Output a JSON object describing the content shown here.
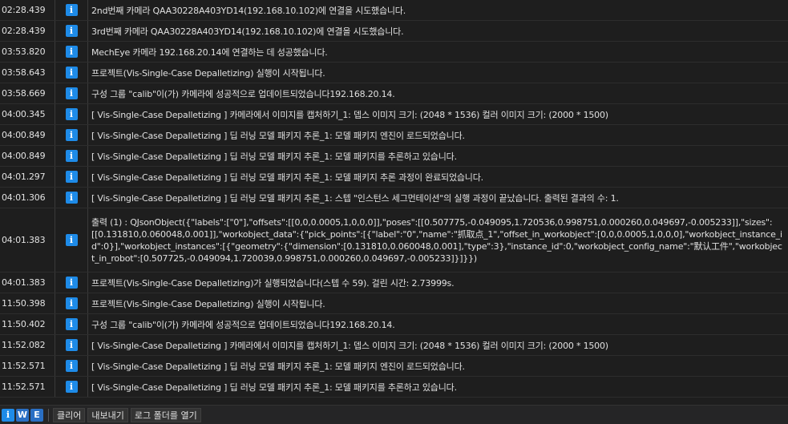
{
  "log_rows": [
    {
      "time": "02:28.439",
      "level": "i",
      "message": "2nd번째 카메라 QAA30228A403YD14(192.168.10.102)에 연결을 시도했습니다."
    },
    {
      "time": "02:28.439",
      "level": "i",
      "message": "3rd번째 카메라 QAA30228A403YD14(192.168.10.102)에 연결을 시도했습니다."
    },
    {
      "time": "03:53.820",
      "level": "i",
      "message": "MechEye 카메라 192.168.20.14에 연결하는 데 성공했습니다."
    },
    {
      "time": "03:58.643",
      "level": "i",
      "message": "프로젝트(Vis-Single-Case Depalletizing) 실행이 시작됩니다."
    },
    {
      "time": "03:58.669",
      "level": "i",
      "message": "구성 그룹 \"calib\"이(가) 카메라에 성공적으로 업데이트되었습니다192.168.20.14."
    },
    {
      "time": "04:00.345",
      "level": "i",
      "message": "[ Vis-Single-Case Depalletizing ] 카메라에서 이미지를 캡처하기_1: 뎁스 이미지 크기: (2048 * 1536)  컬러 이미지 크기: (2000 * 1500)"
    },
    {
      "time": "04:00.849",
      "level": "i",
      "message": "[ Vis-Single-Case Depalletizing ] 딥 러닝 모델 패키지 추론_1: 모델 패키지 엔진이 로드되었습니다."
    },
    {
      "time": "04:00.849",
      "level": "i",
      "message": "[ Vis-Single-Case Depalletizing ] 딥 러닝 모델 패키지 추론_1: 모델 패키지를 추론하고 있습니다."
    },
    {
      "time": "04:01.297",
      "level": "i",
      "message": "[ Vis-Single-Case Depalletizing ] 딥 러닝 모델 패키지 추론_1: 모델 패키지 추론 과정이 완료되었습니다."
    },
    {
      "time": "04:01.306",
      "level": "i",
      "message": "[ Vis-Single-Case Depalletizing ] 딥 러닝 모델 패키지 추론_1: 스텝 \"인스턴스 세그먼테이션\"의 실행 과정이 끝났습니다. 출력된 결과의 수: 1."
    },
    {
      "time": "04:01.383",
      "level": "i",
      "tall": true,
      "message": "출력 (1) : QJsonObject({\"labels\":[\"0\"],\"offsets\":[[0,0,0.0005,1,0,0,0]],\"poses\":[[0.507775,-0.049095,1.720536,0.998751,0.000260,0.049697,-0.005233]],\"sizes\":[[0.131810,0.060048,0.001]],\"workobject_data\":{\"pick_points\":[{\"label\":\"0\",\"name\":\"抓取点_1\",\"offset_in_workobject\":[0,0,0.0005,1,0,0,0],\"workobject_instance_id\":0}],\"workobject_instances\":[{\"geometry\":{\"dimension\":[0.131810,0.060048,0.001],\"type\":3},\"instance_id\":0,\"workobject_config_name\":\"默认工件\",\"workobject_in_robot\":[0.507725,-0.049094,1.720039,0.998751,0.000260,0.049697,-0.005233]}]}})"
    },
    {
      "time": "04:01.383",
      "level": "i",
      "message": "프로젝트(Vis-Single-Case Depalletizing)가 실행되었습니다(스텝 수 59). 걸린 시간: 2.73999s."
    },
    {
      "time": "11:50.398",
      "level": "i",
      "message": "프로젝트(Vis-Single-Case Depalletizing) 실행이 시작됩니다."
    },
    {
      "time": "11:50.402",
      "level": "i",
      "message": "구성 그룹 \"calib\"이(가) 카메라에 성공적으로 업데이트되었습니다192.168.20.14."
    },
    {
      "time": "11:52.082",
      "level": "i",
      "message": "[ Vis-Single-Case Depalletizing ] 카메라에서 이미지를 캡처하기_1: 뎁스 이미지 크기: (2048 * 1536)  컬러 이미지 크기: (2000 * 1500)"
    },
    {
      "time": "11:52.571",
      "level": "i",
      "message": "[ Vis-Single-Case Depalletizing ] 딥 러닝 모델 패키지 추론_1: 모델 패키지 엔진이 로드되었습니다."
    },
    {
      "time": "11:52.571",
      "level": "i",
      "message": "[ Vis-Single-Case Depalletizing ] 딥 러닝 모델 패키지 추론_1: 모델 패키지를 추론하고 있습니다."
    }
  ],
  "toolbar": {
    "filter_info": "i",
    "filter_warning": "W",
    "filter_error": "E",
    "clear_label": "클리어",
    "export_label": "내보내기",
    "open_log_folder_label": "로그 폴더를 열기"
  },
  "colors": {
    "background": "#1e1e1e",
    "info_blue": "#1e8be8",
    "text": "#e0e0e0"
  },
  "icons": {
    "info": "info-icon"
  }
}
